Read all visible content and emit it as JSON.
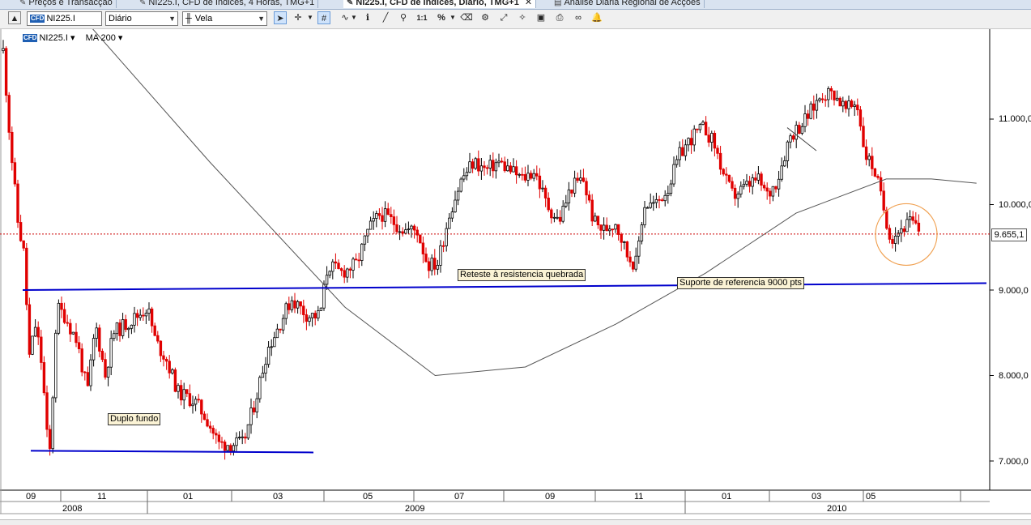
{
  "tabs": [
    {
      "label": "Preços e Transacção",
      "active": false
    },
    {
      "label": "NI225.I, CFD de Índices, 4 Horas, TMG+1",
      "active": false
    },
    {
      "label": "NI225.I, CFD de Índices, Diário, TMG+1",
      "active": true
    },
    {
      "label": "Análise Diária Regional de Acções",
      "active": false
    }
  ],
  "toolbar": {
    "instrument_badge": "CFD",
    "instrument": "NI225.I",
    "period": "Diário",
    "chart_style": "Vela"
  },
  "legend": {
    "instrument": "NI225.I",
    "indicator": "MA 200"
  },
  "annotations": {
    "double_bottom": "Duplo fundo",
    "retest": "Reteste à resistencia quebrada",
    "support": "Suporte de referencia 9000 pts"
  },
  "current_price_label": "9.655,1",
  "chart_data": {
    "type": "candlestick",
    "instrument": "NI225.I",
    "y_ticks": [
      "11.000,0",
      "10.000,0",
      "9.000,0",
      "8.000,0",
      "7.000,0"
    ],
    "y_tick_values": [
      11000,
      10000,
      9000,
      8000,
      7000
    ],
    "ylim": [
      6650,
      11900
    ],
    "current_price": 9655.1,
    "x_month_labels": [
      "09",
      "11",
      "01",
      "03",
      "05",
      "07",
      "09",
      "11",
      "01",
      "03",
      "05"
    ],
    "x_year_labels": [
      "2008",
      "2009",
      "2010"
    ],
    "overlays": {
      "ma200": [
        [
          "2008-09",
          12900
        ],
        [
          "2009-01",
          10500
        ],
        [
          "2009-04",
          8800
        ],
        [
          "2009-06",
          8000
        ],
        [
          "2009-08",
          8100
        ],
        [
          "2009-10",
          8600
        ],
        [
          "2009-12",
          9200
        ],
        [
          "2010-02",
          9900
        ],
        [
          "2010-04",
          10300
        ],
        [
          "2010-05",
          10300
        ],
        [
          "2010-06",
          10250
        ]
      ],
      "support_line_level": 9000,
      "double_bottom_level": 7000
    },
    "colors": {
      "bullish": "#000000",
      "bearish": "#e00000",
      "ma": "#555555",
      "support": "#0000cc",
      "price_line": "#cc0000",
      "highlight": "#f0a050"
    }
  }
}
